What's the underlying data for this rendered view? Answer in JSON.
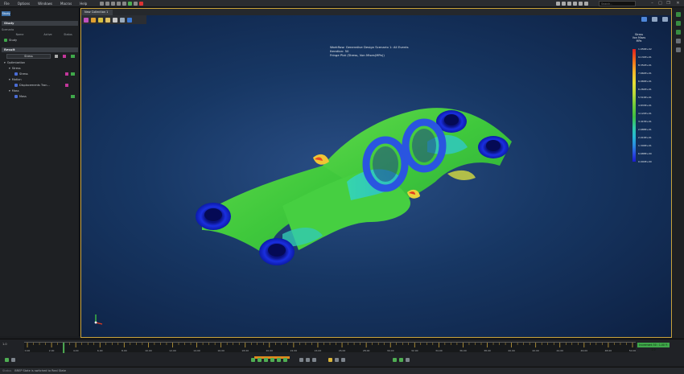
{
  "menu": [
    "File",
    "Options",
    "Windows",
    "Macros",
    "Help"
  ],
  "search": {
    "placeholder": "Search..."
  },
  "left_panel": {
    "tab": "Study",
    "study_header": "Study",
    "scenario_label": "Scenario",
    "columns": [
      "Name",
      "Active",
      "Status"
    ],
    "study_item": "Study",
    "results_header": "Result",
    "dropdown_value": "Stress",
    "tree": [
      {
        "label": "Optimization",
        "indent": 0
      },
      {
        "label": "Stress",
        "indent": 1
      },
      {
        "label": "Stress",
        "indent": 2
      },
      {
        "label": "Motion",
        "indent": 1
      },
      {
        "label": "Displacements Tran...",
        "indent": 2
      },
      {
        "label": "Mass",
        "indent": 1
      },
      {
        "label": "Mass",
        "indent": 2
      }
    ]
  },
  "viewport": {
    "tab_label": "New Collection 1",
    "info_lines": [
      "Workflow: Generative Design Scenario 1: All Events",
      "Iteration: 50",
      "Fringe Plot (Stress, Von Mises(MPa))"
    ],
    "legend": {
      "title_lines": [
        "Stress",
        "Von Mises",
        "MPa"
      ],
      "labels": [
        "1.056E+02",
        "9.134E+01",
        "8.352E+01",
        "7.664E+01",
        "6.966E+01",
        "6.264E+01",
        "5.516E+01",
        "4.833E+01",
        "4.124E+01",
        "3.415E+01",
        "2.688E+01",
        "2.016E+01",
        "1.346E+01",
        "6.688E+00",
        "0.000E+00"
      ]
    }
  },
  "timeline": {
    "ticks": [
      "0.00",
      "2.00",
      "4.00",
      "6.00",
      "8.00",
      "10.00",
      "12.00",
      "14.00",
      "16.00",
      "18.00",
      "20.00",
      "22.00",
      "24.00",
      "26.00",
      "28.00",
      "30.00",
      "32.00",
      "34.00",
      "36.00",
      "38.00",
      "40.00",
      "42.00",
      "44.00",
      "46.00",
      "48.00",
      "50.00"
    ],
    "badge": "Increment 50 : 1.00 Y: 1.0",
    "current_start": "1.0",
    "progress": 0.06
  },
  "status": {
    "label": "Status",
    "message": "BREP State is switched to Real State"
  },
  "colors": {
    "accent": "#c8a23a",
    "green": "#3fa84a"
  }
}
